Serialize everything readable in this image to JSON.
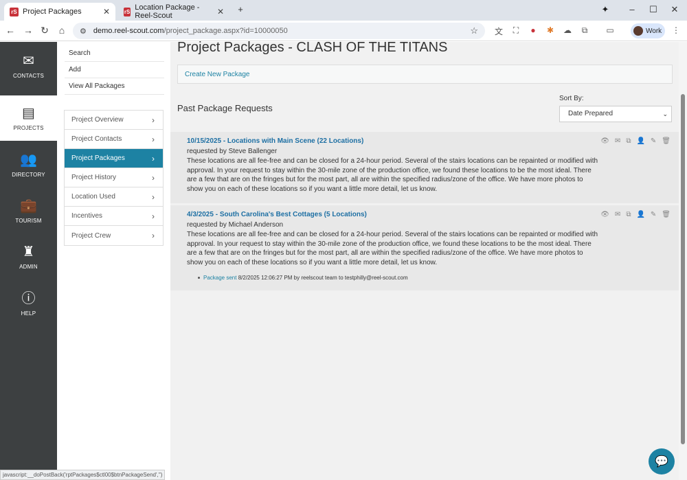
{
  "browser": {
    "tabs": [
      {
        "title": "Project Packages",
        "favicon": "rS"
      },
      {
        "title": "Location Package - Reel-Scout",
        "favicon": "rS"
      }
    ],
    "url_host": "demo.reel-scout.com",
    "url_path": "/project_package.aspx?id=10000050",
    "profile_label": "Work",
    "status_text": "javascript:__doPostBack('rptPackages$ctl00$btnPackageSend','')"
  },
  "leftnav": {
    "items": [
      {
        "label": "CONTACTS",
        "icon": "envelope-icon"
      },
      {
        "label": "PROJECTS",
        "icon": "archive-box-icon"
      },
      {
        "label": "DIRECTORY",
        "icon": "users-icon"
      },
      {
        "label": "TOURISM",
        "icon": "suitcase-icon"
      },
      {
        "label": "ADMIN",
        "icon": "admin-user-icon"
      },
      {
        "label": "HELP",
        "icon": "info-icon"
      }
    ]
  },
  "subnav": {
    "links": [
      "Search",
      "Add",
      "View All Packages"
    ]
  },
  "menu": {
    "items": [
      "Project Overview",
      "Project Contacts",
      "Project Packages",
      "Project History",
      "Location Used",
      "Incentives",
      "Project Crew"
    ]
  },
  "main": {
    "title": "Project Packages - CLASH OF THE TITANS",
    "create_link": "Create New Package",
    "past_heading": "Past Package Requests",
    "sort_label": "Sort By:",
    "sort_value": "Date Prepared",
    "packages": [
      {
        "title": "10/15/2025 - Locations with Main Scene (22 Locations)",
        "requested_by": "requested by Steve Ballenger",
        "description": "These locations are all fee-free and can be closed for a 24-hour period. Several of the stairs locations can be repainted or modified with approval. In your request to stay within the 30-mile zone of the production office, we found these locations to be the most ideal. There are a few that are on the fringes but for the most part, all are within the specified radius/zone of the office. We have more photos to show you on each of these locations so if you want a little more detail, let us know."
      },
      {
        "title": "4/3/2025 - South Carolina's Best Cottages (5 Locations)",
        "requested_by": "requested by Michael Anderson",
        "description": "These locations are all fee-free and can be closed for a 24-hour period. Several of the stairs locations can be repainted or modified with approval. In your request to stay within the 30-mile zone of the production office, we found these locations to be the most ideal. There are a few that are on the fringes but for the most part, all are within the specified radius/zone of the office. We have more photos to show you on each of these locations so if you want a little more detail, let us know.",
        "sent_link": "Package sent",
        "sent_text": " 8/2/2025 12:06:27 PM by reelscout team to testphilly@reel-scout.com"
      }
    ]
  },
  "colors": {
    "accent": "#1d82a3",
    "sidebar": "#3d4041"
  }
}
